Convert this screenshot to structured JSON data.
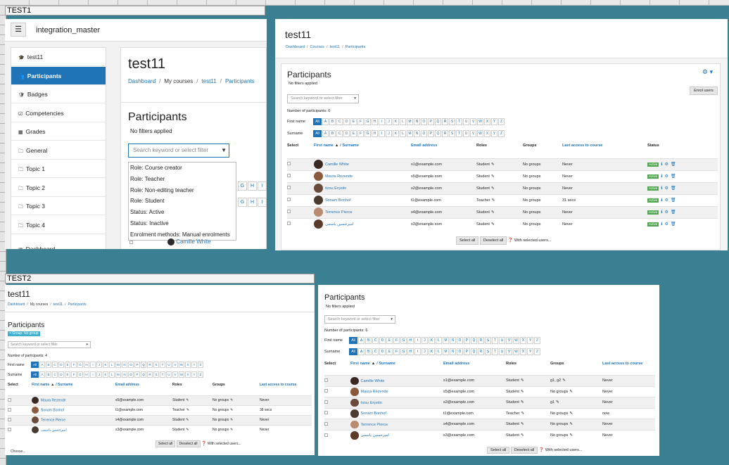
{
  "sheet": {
    "label_top": "TEST1",
    "label_bottom": "TEST2"
  },
  "shot_a": {
    "app_title": "integration_master",
    "nav": [
      "test11",
      "Participants",
      "Badges",
      "Competencies",
      "Grades",
      "General",
      "Topic 1",
      "Topic 2",
      "Topic 3",
      "Topic 4",
      "Dashboard"
    ],
    "course_title": "test11",
    "crumbs": [
      "Dashboard",
      "My courses",
      "test11",
      "Participants"
    ],
    "heading": "Participants",
    "filters": "No filters applied",
    "search_placeholder": "Search keyword or select filter",
    "options": [
      "Role: Course creator",
      "Role: Teacher",
      "Role: Non-editing teacher",
      "Role: Student",
      "Status: Active",
      "Status: Inactive",
      "Enrolment methods: Manual enrolments"
    ],
    "alpha_peek": [
      "G",
      "H",
      "I"
    ],
    "row_name": "Camille White"
  },
  "shot_b": {
    "course_title": "test11",
    "crumbs": [
      "Dashboard",
      "Courses",
      "test11",
      "Participants"
    ],
    "heading": "Participants",
    "filters": "No filters applied",
    "search_placeholder": "Search keyword or select filter",
    "enrol_button": "Enrol users",
    "count": "Number of participants: 6",
    "firstname_label": "First name",
    "surname_label": "Surname",
    "headers": [
      "Select",
      "First name",
      "/ Surname",
      "Email address",
      "Roles",
      "Groups",
      "Last access to course",
      "Status"
    ],
    "rows": [
      {
        "name": "Camille White",
        "email": "s1@example.com",
        "role": "Student",
        "groups": "No groups",
        "access": "Never",
        "status": "Active"
      },
      {
        "name": "Maura Rezende",
        "email": "s5@example.com",
        "role": "Student",
        "groups": "No groups",
        "access": "Never",
        "status": "Active"
      },
      {
        "name": "özsu Erçetin",
        "email": "s2@example.com",
        "role": "Student",
        "groups": "No groups",
        "access": "Never",
        "status": "Active"
      },
      {
        "name": "Sonam Bonhof",
        "email": "t1@example.com",
        "role": "Teacher",
        "groups": "No groups",
        "access": "31 secs",
        "status": "Active"
      },
      {
        "name": "Terrence Pierce",
        "email": "s4@example.com",
        "role": "Student",
        "groups": "No groups",
        "access": "Never",
        "status": "Active"
      },
      {
        "name": "امیرحسین یاسمی",
        "email": "s3@example.com",
        "role": "Student",
        "groups": "No groups",
        "access": "Never",
        "status": "Active"
      }
    ],
    "select_all": "Select all",
    "deselect_all": "Deselect all",
    "with_selected": "With selected users..."
  },
  "shot_c": {
    "course_title": "test11",
    "crumbs": [
      "Dashboard",
      "My courses",
      "test11",
      "Participants"
    ],
    "heading": "Participants",
    "group_badge": "× Group: No group",
    "search_placeholder": "Search keyword or select filter",
    "count": "Number of participants: 4",
    "firstname_label": "First name",
    "surname_label": "Surname",
    "headers": [
      "Select",
      "First name",
      "/ Surname",
      "Email address",
      "Roles",
      "Groups",
      "Last access to course"
    ],
    "rows": [
      {
        "name": "Maura Rezende",
        "email": "s5@example.com",
        "role": "Student",
        "groups": "No groups",
        "access": "Never"
      },
      {
        "name": "Sonam Bonhof",
        "email": "t1@example.com",
        "role": "Teacher",
        "groups": "No groups",
        "access": "38 secs"
      },
      {
        "name": "Terrence Pierce",
        "email": "s4@example.com",
        "role": "Student",
        "groups": "No groups",
        "access": "Never"
      },
      {
        "name": "امیرحسین یاسمی",
        "email": "s3@example.com",
        "role": "Student",
        "groups": "No groups",
        "access": "Never"
      }
    ],
    "select_all": "Select all",
    "deselect_all": "Deselect all",
    "with_selected": "With selected users...",
    "choose": "Choose..."
  },
  "shot_d": {
    "heading": "Participants",
    "filters": "No filters applied",
    "search_placeholder": "Search keyword or select filter",
    "count": "Number of participants: 6",
    "firstname_label": "First name",
    "surname_label": "Surname",
    "headers": [
      "Select",
      "First name",
      "/ Surname",
      "Email address",
      "Roles",
      "Groups",
      "Last access to course"
    ],
    "rows": [
      {
        "name": "Camille White",
        "email": "s1@example.com",
        "role": "Student",
        "groups": "g1, g2",
        "access": "Never"
      },
      {
        "name": "Maura Rezende",
        "email": "s5@example.com",
        "role": "Student",
        "groups": "No groups",
        "access": "Never"
      },
      {
        "name": "özsu Erçetin",
        "email": "s2@example.com",
        "role": "Student",
        "groups": "g1",
        "access": "Never"
      },
      {
        "name": "Sonam Bonhof",
        "email": "t1@example.com",
        "role": "Teacher",
        "groups": "No groups",
        "access": "now"
      },
      {
        "name": "Terrence Pierce",
        "email": "s4@example.com",
        "role": "Student",
        "groups": "No groups",
        "access": "Never"
      },
      {
        "name": "امیرحسین یاسمی",
        "email": "s3@example.com",
        "role": "Student",
        "groups": "No groups",
        "access": "Never"
      }
    ],
    "select_all": "Select all",
    "deselect_all": "Deselect all",
    "with_selected": "With selected users..."
  },
  "alphabet": [
    "All",
    "A",
    "B",
    "C",
    "D",
    "E",
    "F",
    "G",
    "H",
    "I",
    "J",
    "K",
    "L",
    "M",
    "N",
    "O",
    "P",
    "Q",
    "R",
    "S",
    "T",
    "U",
    "V",
    "W",
    "X",
    "Y",
    "Z"
  ],
  "icons": {
    "pencil": "pencil-icon",
    "info": "info-icon",
    "gear": "gear-icon",
    "trash": "trash-icon"
  },
  "colors": {
    "accent": "#1f73b7",
    "active": "#52a650",
    "nav_active": "#1f73b7",
    "background": "#3a7f92"
  }
}
